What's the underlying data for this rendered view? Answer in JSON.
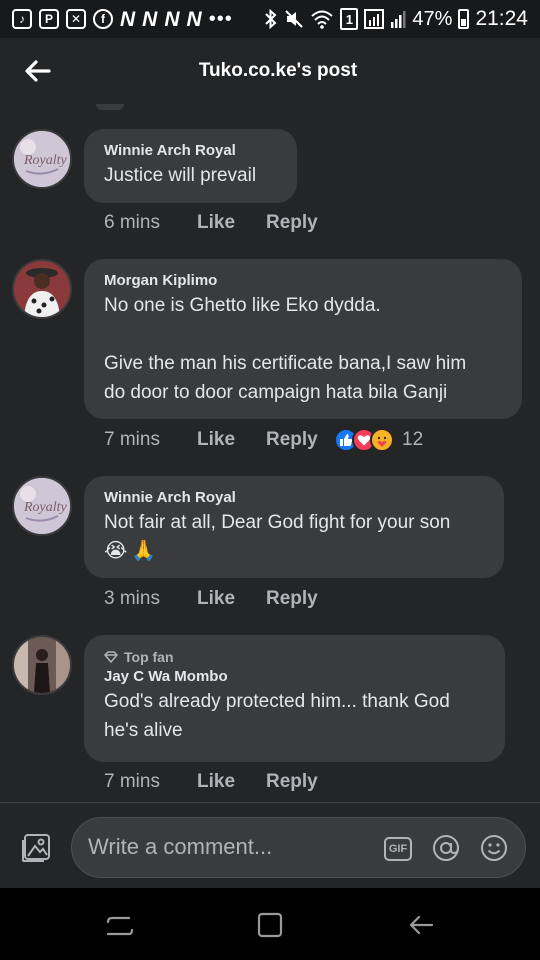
{
  "status_bar": {
    "notif_letters": [
      "N",
      "N",
      "N",
      "N"
    ],
    "more": "•••",
    "sim_badge": "1",
    "battery_percent": "47%",
    "time": "21:24"
  },
  "header": {
    "title": "Tuko.co.ke's post"
  },
  "comments": [
    {
      "author": "Winnie Arch Royal",
      "top_fan": "",
      "text_lines": [
        "Justice will prevail"
      ],
      "time": "6 mins",
      "like": "Like",
      "reply": "Reply",
      "reaction_count": ""
    },
    {
      "author": "Morgan Kiplimo",
      "top_fan": "",
      "text_lines": [
        "No one is Ghetto like Eko dydda.",
        "",
        "Give the man his certificate bana,I saw him",
        "do door to door campaign hata bila Ganji"
      ],
      "time": "7 mins",
      "like": "Like",
      "reply": "Reply",
      "reaction_count": "12"
    },
    {
      "author": "Winnie Arch Royal",
      "top_fan": "",
      "text_lines": [
        "Not fair at all, Dear God fight for your son",
        "😭🙏"
      ],
      "time": "3 mins",
      "like": "Like",
      "reply": "Reply",
      "reaction_count": ""
    },
    {
      "author": "Jay C Wa Mombo",
      "top_fan": "Top fan",
      "text_lines": [
        "God's already protected him... thank God",
        "he's alive"
      ],
      "time": "7 mins",
      "like": "Like",
      "reply": "Reply",
      "reaction_count": ""
    }
  ],
  "composer": {
    "placeholder": "Write a comment...",
    "gif_label": "GIF"
  },
  "colors": {
    "background": "#242526",
    "bubble": "#3a3b3c",
    "text": "#e4e6eb",
    "muted": "#b0b3b8",
    "like_blue": "#1877f2",
    "love_red": "#f33e58",
    "care_yellow": "#f7b125"
  },
  "icons": [
    "back-arrow-icon",
    "photo-icon",
    "gif-icon",
    "at-icon",
    "emoji-icon",
    "like-reaction-icon",
    "love-reaction-icon",
    "care-reaction-icon",
    "diamond-icon",
    "recent-apps-icon",
    "home-icon",
    "android-back-icon"
  ]
}
